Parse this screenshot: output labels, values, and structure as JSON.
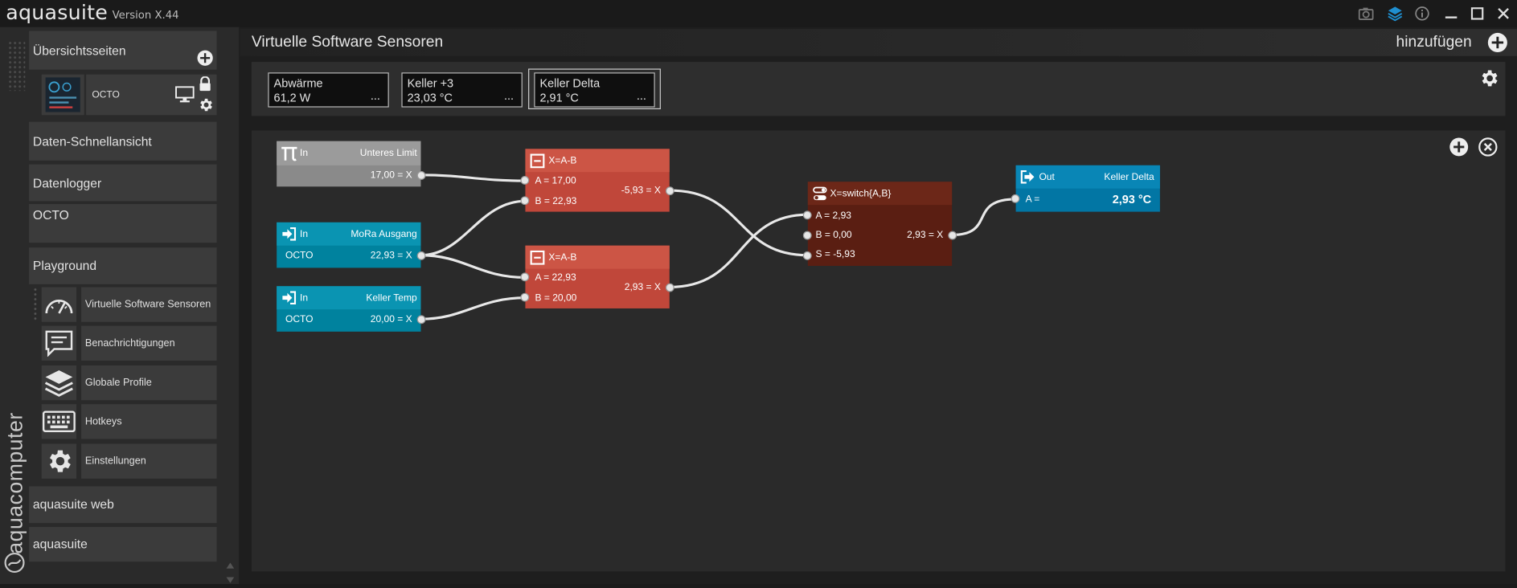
{
  "app": {
    "name": "aquasuite",
    "version": "Version X.44"
  },
  "titlebar": {
    "icons": [
      "camera-icon",
      "layers-icon",
      "info-icon",
      "minimize-icon",
      "maximize-icon",
      "close-icon"
    ]
  },
  "sidebar": {
    "overview_label": "Übersichtsseiten",
    "overview_page": {
      "name": "OCTO"
    },
    "items": [
      "Daten-Schnellansicht",
      "Datenlogger",
      "OCTO",
      "Playground"
    ],
    "sub_items": [
      "Virtuelle Software Sensoren",
      "Benachrichtigungen",
      "Globale Profile",
      "Hotkeys",
      "Einstellungen"
    ],
    "bottom_items": [
      "aquasuite web",
      "aquasuite"
    ],
    "brand": "aquacomputer"
  },
  "header": {
    "title": "Virtuelle Software Sensoren",
    "add_label": "hinzufügen"
  },
  "sensors": [
    {
      "name": "Abwärme",
      "value": "61,2 W",
      "dots": "..."
    },
    {
      "name": "Keller +3",
      "value": "23,03 °C",
      "dots": "..."
    },
    {
      "name": "Keller Delta",
      "value": "2,91 °C",
      "dots": "..."
    }
  ],
  "nodes": {
    "const": {
      "type": "In",
      "name": "Unteres Limit",
      "out": "17,00 = X"
    },
    "mora": {
      "type": "In",
      "name": "MoRa Ausgang",
      "source": "OCTO",
      "out": "22,93 = X"
    },
    "keller": {
      "type": "In",
      "name": "Keller Temp",
      "source": "OCTO",
      "out": "20,00 = X"
    },
    "sub1": {
      "title": "X=A-B",
      "a": "A = 17,00",
      "b": "B = 22,93",
      "out": "-5,93 = X"
    },
    "sub2": {
      "title": "X=A-B",
      "a": "A = 22,93",
      "b": "B =  20,00",
      "out": "2,93 = X"
    },
    "switch": {
      "title": "X=switch{A,B}",
      "a": "A = 2,93",
      "b": "B = 0,00",
      "s": "S =  -5,93",
      "out": "2,93 = X"
    },
    "output": {
      "type": "Out",
      "name": "Keller Delta",
      "a": "A =",
      "value": "2,93 °C"
    }
  },
  "colors": {
    "accent_teal": "#00829e",
    "node_red": "#c0473a",
    "node_darkred": "#5a1e12",
    "node_blue": "#0276a4",
    "node_gray": "#8a8a8a"
  }
}
